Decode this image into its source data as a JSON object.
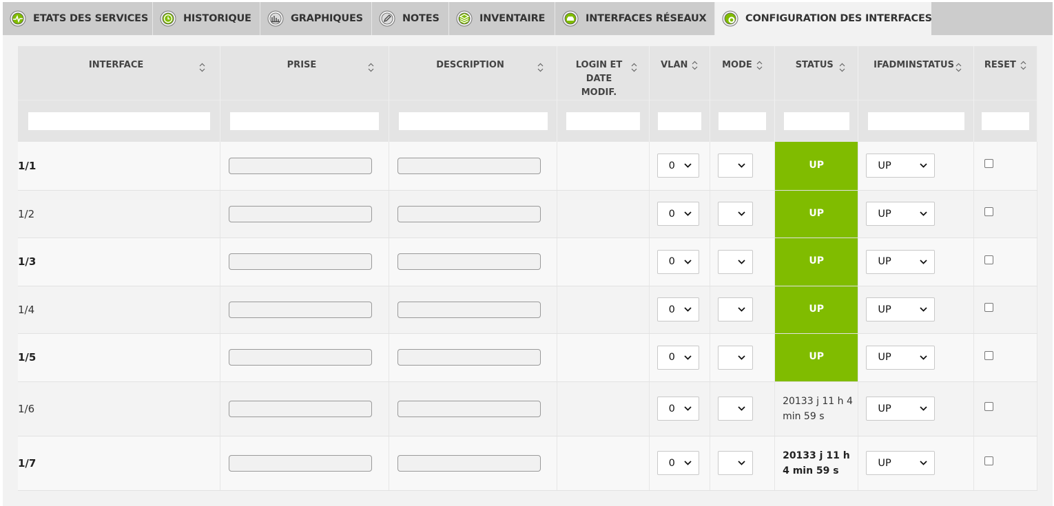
{
  "tabs": [
    {
      "label": "ETATS DES SERVICES",
      "icon": "heartbeat-icon",
      "active": false
    },
    {
      "label": "HISTORIQUE",
      "icon": "clock-history-icon",
      "active": false
    },
    {
      "label": "GRAPHIQUES",
      "icon": "bar-chart-icon",
      "active": false
    },
    {
      "label": "NOTES",
      "icon": "pencil-icon",
      "active": false
    },
    {
      "label": "INVENTAIRE",
      "icon": "stack-icon",
      "active": false
    },
    {
      "label": "INTERFACES RÉSEAUX",
      "icon": "network-interface-icon",
      "active": false
    },
    {
      "label": "CONFIGURATION DES INTERFACES",
      "icon": "gear-config-icon",
      "active": true
    }
  ],
  "colors": {
    "accent_green": "#80bc00",
    "tab_bar": "#cccccc",
    "active_tab": "#f2f2f2",
    "header_bg": "#e4e4e4"
  },
  "table": {
    "columns": [
      {
        "label": "INTERFACE",
        "sortable": true
      },
      {
        "label": "PRISE",
        "sortable": true
      },
      {
        "label": "DESCRIPTION",
        "sortable": true
      },
      {
        "label": "LOGIN ET DATE MODIF.",
        "sortable": true
      },
      {
        "label": "VLAN",
        "sortable": true
      },
      {
        "label": "MODE",
        "sortable": true
      },
      {
        "label": "STATUS",
        "sortable": true
      },
      {
        "label": "IFADMINSTATUS",
        "sortable": true
      },
      {
        "label": "RESET",
        "sortable": true
      }
    ],
    "login_label_lines": [
      "LOGIN ET",
      "DATE",
      "MODIF."
    ],
    "rows": [
      {
        "interface": "1/1",
        "prise": "",
        "description": "",
        "login": "",
        "vlan": "0",
        "mode": "",
        "status": "UP",
        "status_up": true,
        "ifadminstatus": "UP",
        "reset": false
      },
      {
        "interface": "1/2",
        "prise": "",
        "description": "",
        "login": "",
        "vlan": "0",
        "mode": "",
        "status": "UP",
        "status_up": true,
        "ifadminstatus": "UP",
        "reset": false
      },
      {
        "interface": "1/3",
        "prise": "",
        "description": "",
        "login": "",
        "vlan": "0",
        "mode": "",
        "status": "UP",
        "status_up": true,
        "ifadminstatus": "UP",
        "reset": false
      },
      {
        "interface": "1/4",
        "prise": "",
        "description": "",
        "login": "",
        "vlan": "0",
        "mode": "",
        "status": "UP",
        "status_up": true,
        "ifadminstatus": "UP",
        "reset": false
      },
      {
        "interface": "1/5",
        "prise": "",
        "description": "",
        "login": "",
        "vlan": "0",
        "mode": "",
        "status": "UP",
        "status_up": true,
        "ifadminstatus": "UP",
        "reset": false
      },
      {
        "interface": "1/6",
        "prise": "",
        "description": "",
        "login": "",
        "vlan": "0",
        "mode": "",
        "status": "20133 j 11 h 4 min 59 s",
        "status_up": false,
        "ifadminstatus": "UP",
        "reset": false
      },
      {
        "interface": "1/7",
        "prise": "",
        "description": "",
        "login": "",
        "vlan": "0",
        "mode": "",
        "status": "20133 j 11 h 4 min 59 s",
        "status_up": false,
        "ifadminstatus": "UP",
        "reset": false
      }
    ]
  }
}
